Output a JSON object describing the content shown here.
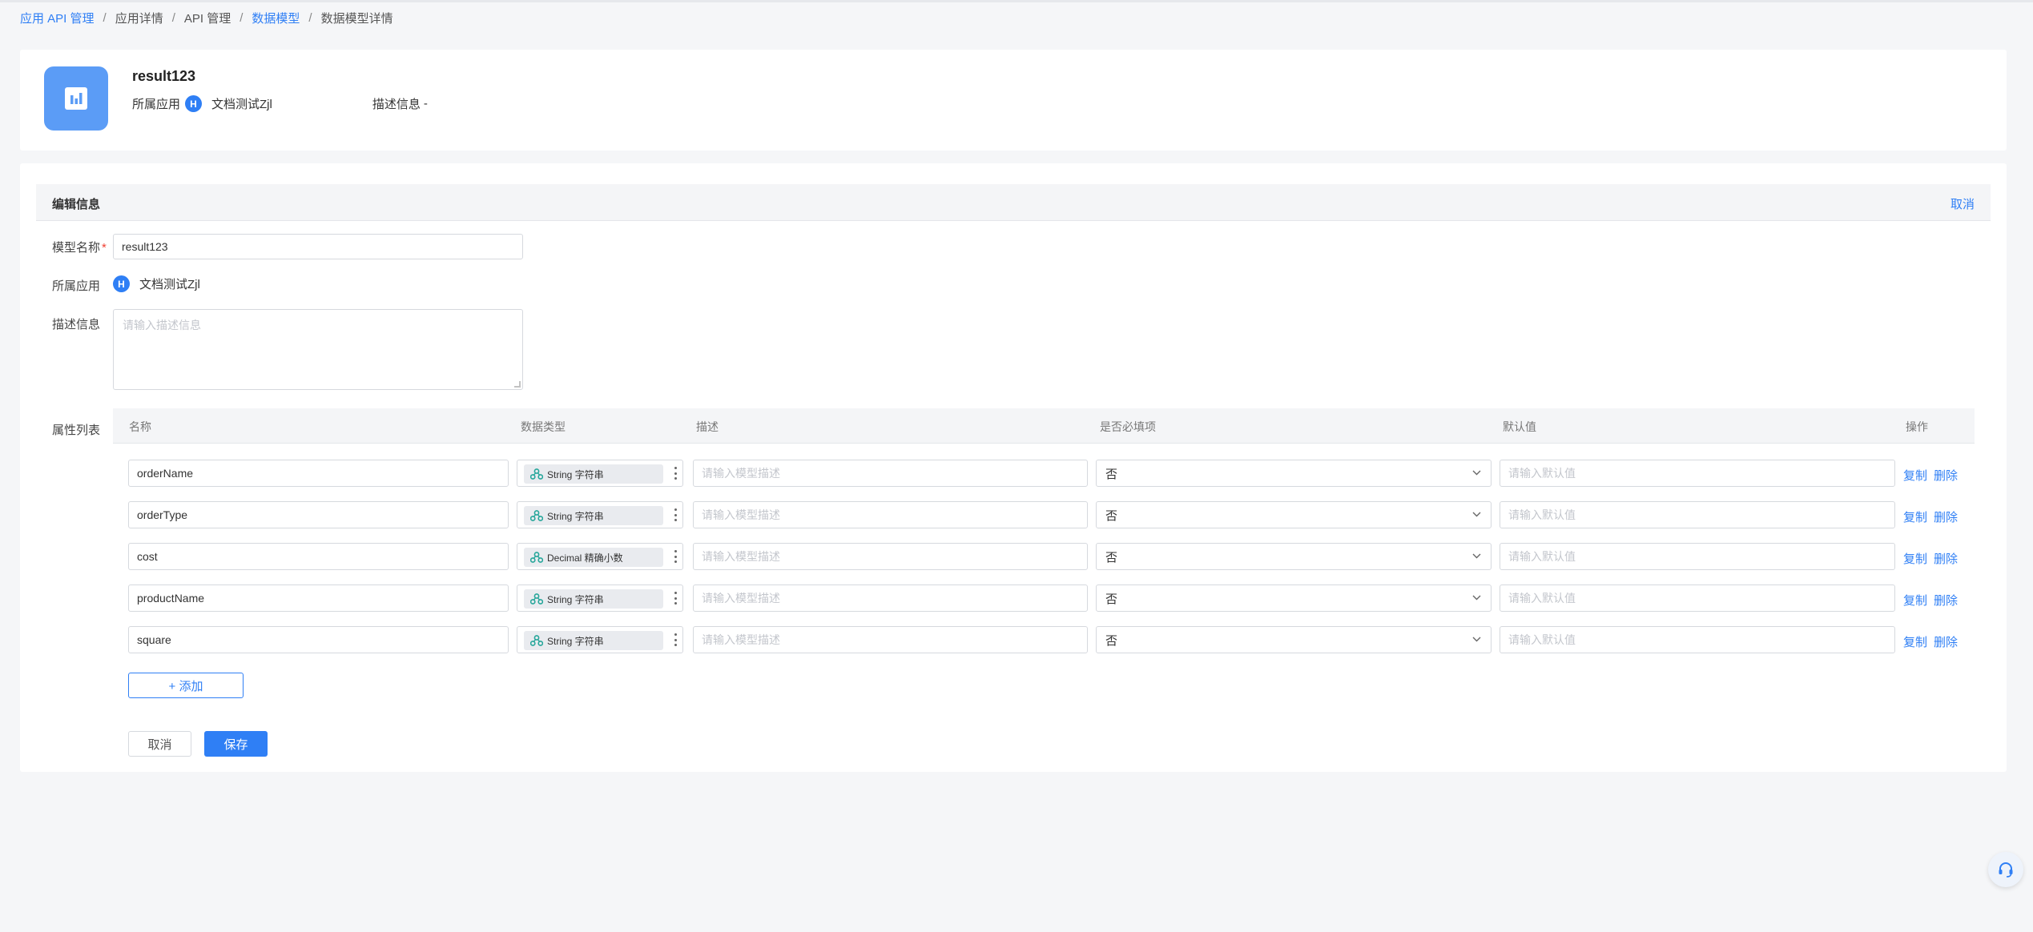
{
  "breadcrumb": {
    "items": [
      "应用 API 管理",
      "应用详情",
      "API 管理",
      "数据模型",
      "数据模型详情"
    ],
    "separator": "/"
  },
  "info": {
    "title": "result123",
    "app_label": "所属应用",
    "app_badge": "H",
    "app_name": "文档测试Zjl",
    "desc_label": "描述信息",
    "desc_value": "-"
  },
  "edit": {
    "header_title": "编辑信息",
    "header_cancel": "取消",
    "name_label": "模型名称",
    "name_required": "*",
    "name_value": "result123",
    "app_label": "所属应用",
    "app_badge": "H",
    "app_name": "文档测试Zjl",
    "desc_label": "描述信息",
    "desc_placeholder": "请输入描述信息",
    "attr_label": "属性列表"
  },
  "table": {
    "columns": [
      "名称",
      "数据类型",
      "描述",
      "是否必填项",
      "默认值",
      "操作"
    ],
    "desc_placeholder": "请输入模型描述",
    "default_placeholder": "请输入默认值",
    "copy_label": "复制",
    "delete_label": "删除",
    "rows": [
      {
        "name": "orderName",
        "type": "String 字符串",
        "required": "否"
      },
      {
        "name": "orderType",
        "type": "String 字符串",
        "required": "否"
      },
      {
        "name": "cost",
        "type": "Decimal 精确小数",
        "required": "否"
      },
      {
        "name": "productName",
        "type": "String 字符串",
        "required": "否"
      },
      {
        "name": "square",
        "type": "String 字符串",
        "required": "否"
      }
    ]
  },
  "buttons": {
    "add": "+ 添加",
    "cancel": "取消",
    "save": "保存"
  },
  "icons": {
    "model": "bar-chart-icon",
    "type": "data-node-icon",
    "help": "headset-icon"
  },
  "colors": {
    "accent": "#2f7ff5",
    "type_icon": "#26a69a",
    "required_mark": "#f04134"
  }
}
